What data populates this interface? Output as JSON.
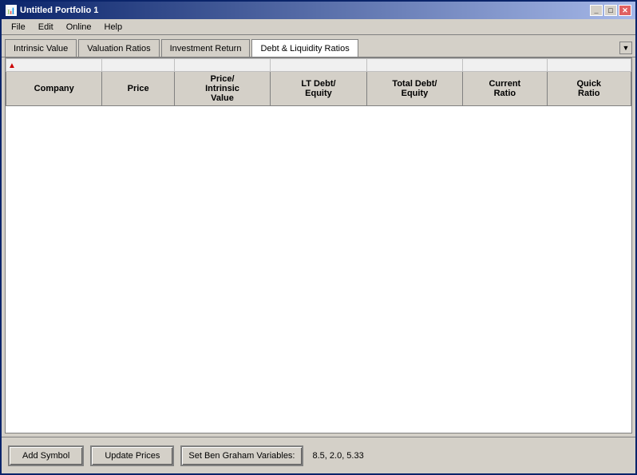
{
  "window": {
    "title": "Untitled Portfolio 1",
    "icon": "📊"
  },
  "titlebar": {
    "minimize_label": "_",
    "maximize_label": "□",
    "close_label": "✕"
  },
  "menubar": {
    "items": [
      {
        "label": "File"
      },
      {
        "label": "Edit"
      },
      {
        "label": "Online"
      },
      {
        "label": "Help"
      }
    ]
  },
  "tabs": [
    {
      "label": "Intrinsic Value",
      "active": false
    },
    {
      "label": "Valuation Ratios",
      "active": false
    },
    {
      "label": "Investment Return",
      "active": false
    },
    {
      "label": "Debt & Liquidity Ratios",
      "active": true
    }
  ],
  "table": {
    "sort_icon": "▲",
    "columns": [
      {
        "label": "Company"
      },
      {
        "label": "Price"
      },
      {
        "label": "Price/\nIntrinsic\nValue"
      },
      {
        "label": "LT Debt/\nEquity"
      },
      {
        "label": "Total Debt/\nEquity"
      },
      {
        "label": "Current\nRatio"
      },
      {
        "label": "Quick\nRatio"
      }
    ],
    "rows": []
  },
  "bottombar": {
    "add_symbol_label": "Add Symbol",
    "update_prices_label": "Update Prices",
    "set_graham_label": "Set Ben Graham Variables:",
    "graham_values": "8.5, 2.0, 5.33"
  }
}
